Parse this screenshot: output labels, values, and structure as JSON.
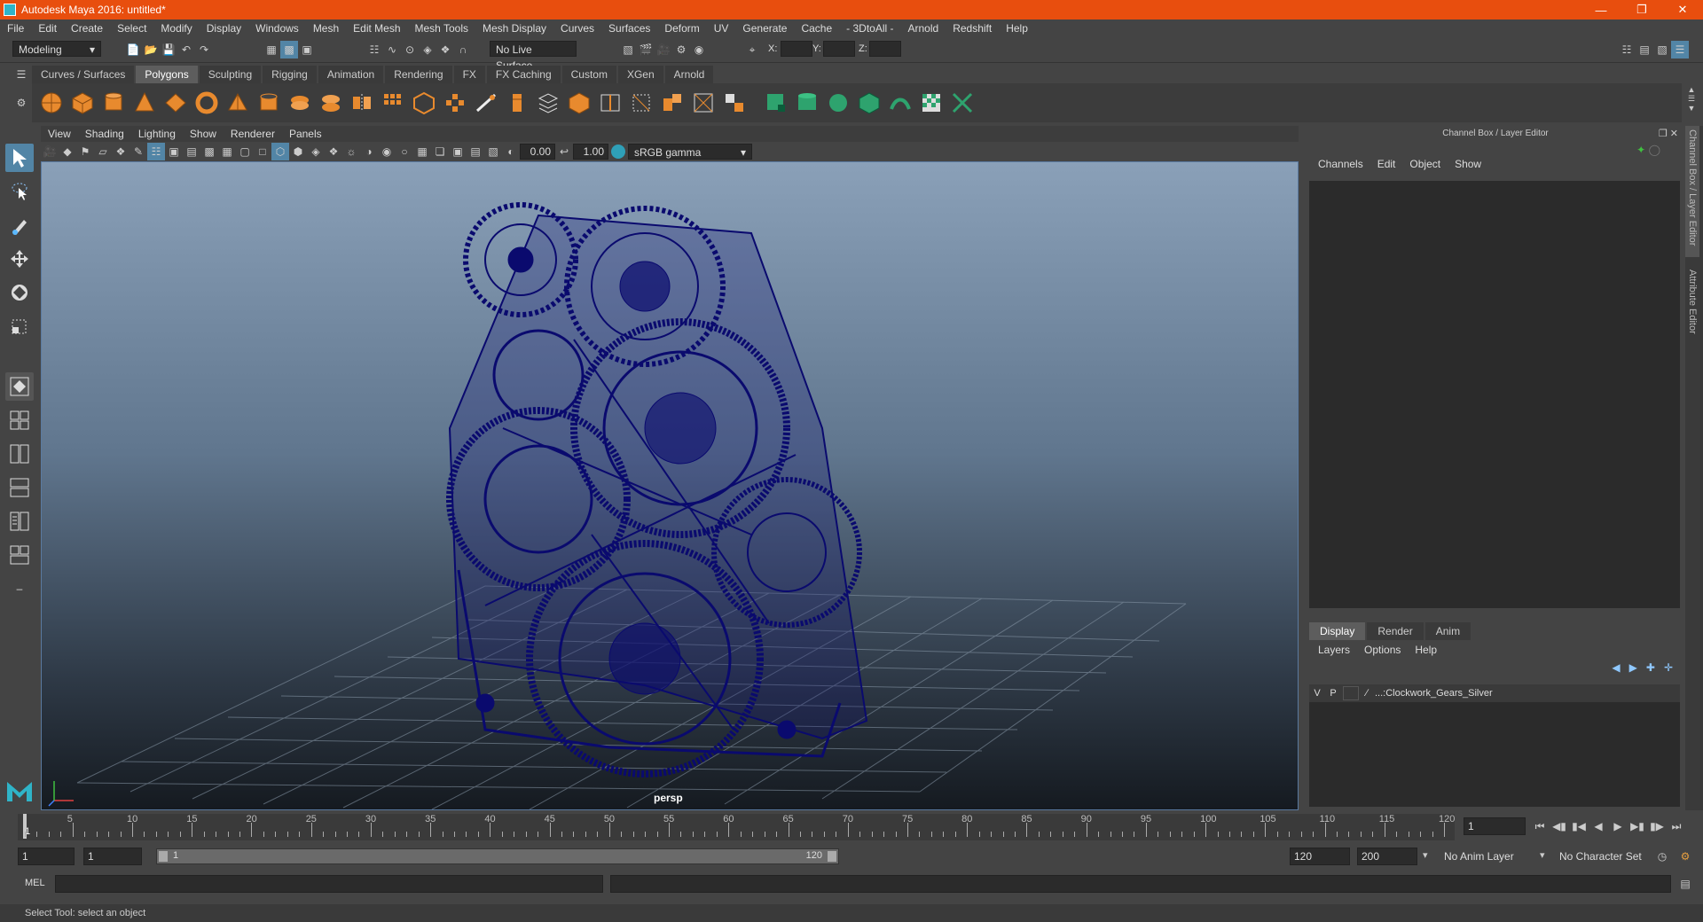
{
  "window": {
    "title": "Autodesk Maya 2016: untitled*"
  },
  "menu": [
    "File",
    "Edit",
    "Create",
    "Select",
    "Modify",
    "Display",
    "Windows",
    "Mesh",
    "Edit Mesh",
    "Mesh Tools",
    "Mesh Display",
    "Curves",
    "Surfaces",
    "Deform",
    "UV",
    "Generate",
    "Cache",
    "- 3DtoAll -",
    "Arnold",
    "Redshift",
    "Help"
  ],
  "status": {
    "mode": "Modeling",
    "live_surface": "No Live Surface",
    "x_label": "X:",
    "y_label": "Y:",
    "z_label": "Z:"
  },
  "shelf": {
    "tabs": [
      "Curves / Surfaces",
      "Polygons",
      "Sculpting",
      "Rigging",
      "Animation",
      "Rendering",
      "FX",
      "FX Caching",
      "Custom",
      "XGen",
      "Arnold"
    ],
    "active": 1
  },
  "viewport": {
    "menus": [
      "View",
      "Shading",
      "Lighting",
      "Show",
      "Renderer",
      "Panels"
    ],
    "exposure": "0.00",
    "gamma": "1.00",
    "colorspace": "sRGB gamma",
    "camera_label": "persp"
  },
  "channelbox": {
    "header": "Channel Box / Layer Editor",
    "menus": [
      "Channels",
      "Edit",
      "Object",
      "Show"
    ]
  },
  "layer_editor": {
    "tabs": [
      "Display",
      "Render",
      "Anim"
    ],
    "active": 0,
    "menus": [
      "Layers",
      "Options",
      "Help"
    ],
    "layers": [
      {
        "v": "V",
        "p": "P",
        "name": "...:Clockwork_Gears_Silver"
      }
    ]
  },
  "side_tabs": [
    "Channel Box / Layer Editor",
    "Attribute Editor"
  ],
  "timeline": {
    "labels": [
      "5",
      "10",
      "15",
      "20",
      "25",
      "30",
      "35",
      "40",
      "45",
      "50",
      "55",
      "60",
      "65",
      "70",
      "75",
      "80",
      "85",
      "90",
      "95",
      "100",
      "105",
      "110",
      "115",
      "120"
    ],
    "start_marker": "1",
    "current_frame": "1"
  },
  "range": {
    "start": "1",
    "inner_start": "1",
    "slider_start": "1",
    "slider_end": "120",
    "end": "120",
    "max": "200",
    "anim_layer": "No Anim Layer",
    "char_set": "No Character Set"
  },
  "mel": {
    "label": "MEL"
  },
  "help_line": "Select Tool: select an object",
  "colors": {
    "title_bar": "#e84e0e",
    "wireframe": "#0a0a6e",
    "active_tool": "#5285a6"
  }
}
